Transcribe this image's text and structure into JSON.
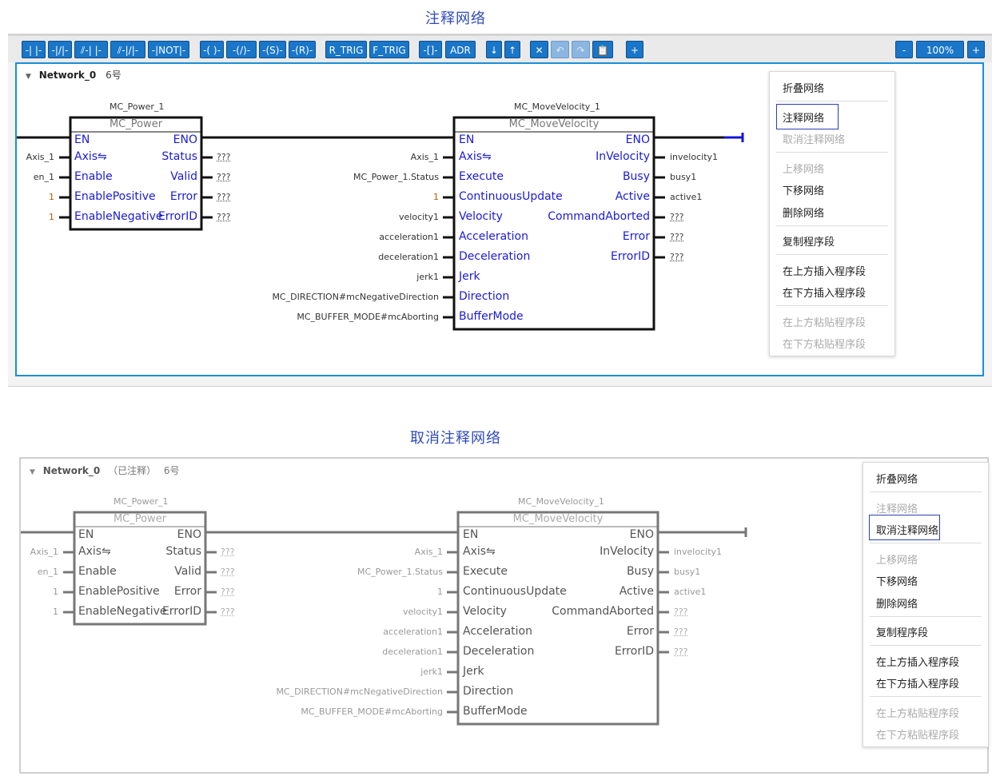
{
  "titles": {
    "top": "注释网络",
    "bottom": "取消注释网络"
  },
  "toolbar": {
    "buttons": [
      "-| |-",
      "-|/|-",
      "⫽-| |-",
      "⫽-|/|-",
      "-|NOT|-",
      "-( )-",
      "-(/)-",
      "-(S)-",
      "-(R)-",
      "R_TRIG",
      "F_TRIG",
      "-[]-",
      "ADR",
      "↓",
      "↑",
      "✕",
      "↶",
      "↷",
      "📋",
      "+"
    ],
    "zoom_out": "-",
    "zoom_value": "100%",
    "zoom_in": "+"
  },
  "network1": {
    "collapse_glyph": "▼",
    "name": "Network_0",
    "status": "",
    "count": "6号"
  },
  "network2": {
    "collapse_glyph": "▼",
    "name": "Network_0",
    "status": "（已注释）",
    "count": "6号"
  },
  "power": {
    "instance": "MC_Power_1",
    "type": "MC_Power",
    "inputs": [
      "EN",
      "Axis⇋",
      "Enable",
      "EnablePositive",
      "EnableNegative"
    ],
    "outputs": [
      "ENO",
      "Status",
      "Valid",
      "Error",
      "ErrorID"
    ],
    "in_vars": [
      "",
      "Axis_1",
      "en_1",
      "1",
      "1"
    ],
    "out_vars": [
      "",
      "???",
      "???",
      "???",
      "???"
    ]
  },
  "move": {
    "instance": "MC_MoveVelocity_1",
    "type": "MC_MoveVelocity",
    "inputs": [
      "EN",
      "Axis⇋",
      "Execute",
      "ContinuousUpdate",
      "Velocity",
      "Acceleration",
      "Deceleration",
      "Jerk",
      "Direction",
      "BufferMode"
    ],
    "outputs": [
      "ENO",
      "InVelocity",
      "Busy",
      "Active",
      "CommandAborted",
      "Error",
      "ErrorID"
    ],
    "in_vars": [
      "",
      "Axis_1",
      "MC_Power_1.Status",
      "1",
      "velocity1",
      "acceleration1",
      "deceleration1",
      "jerk1",
      "MC_DIRECTION#mcNegativeDirection",
      "MC_BUFFER_MODE#mcAborting"
    ],
    "out_vars": [
      "",
      "invelocity1",
      "busy1",
      "active1",
      "???",
      "???",
      "???"
    ]
  },
  "menu1": {
    "items": [
      {
        "label": "折叠网络",
        "enabled": true
      },
      {
        "label": "注释网络",
        "enabled": true
      },
      {
        "label": "取消注释网络",
        "enabled": false
      },
      {
        "label": "上移网络",
        "enabled": false
      },
      {
        "label": "下移网络",
        "enabled": true
      },
      {
        "label": "删除网络",
        "enabled": true
      },
      {
        "label": "复制程序段",
        "enabled": true
      },
      {
        "label": "在上方插入程序段",
        "enabled": true
      },
      {
        "label": "在下方插入程序段",
        "enabled": true
      },
      {
        "label": "在上方粘贴程序段",
        "enabled": false
      },
      {
        "label": "在下方粘贴程序段",
        "enabled": false
      }
    ]
  },
  "menu2": {
    "items": [
      {
        "label": "折叠网络",
        "enabled": true
      },
      {
        "label": "注释网络",
        "enabled": false
      },
      {
        "label": "取消注释网络",
        "enabled": true
      },
      {
        "label": "上移网络",
        "enabled": false
      },
      {
        "label": "下移网络",
        "enabled": true
      },
      {
        "label": "删除网络",
        "enabled": true
      },
      {
        "label": "复制程序段",
        "enabled": true
      },
      {
        "label": "在上方插入程序段",
        "enabled": true
      },
      {
        "label": "在下方插入程序段",
        "enabled": true
      },
      {
        "label": "在上方粘贴程序段",
        "enabled": false
      },
      {
        "label": "在下方粘贴程序段",
        "enabled": false
      }
    ]
  },
  "colors": {
    "accent": "#1976c8",
    "title": "#2f4bbf",
    "pin_active": "#1a1adb",
    "rung_active": "#1414d8",
    "border_active": "#1a8fd8"
  }
}
